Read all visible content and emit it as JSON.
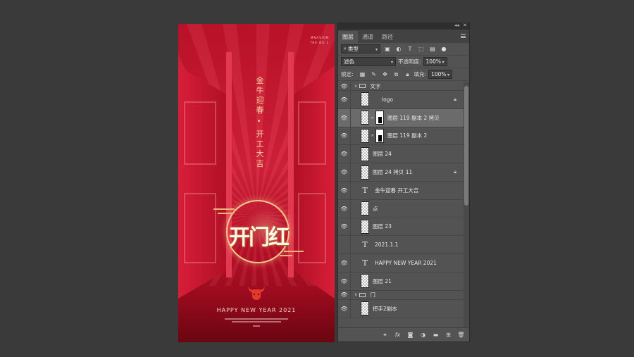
{
  "poster": {
    "brand_line1": "MNASION",
    "brand_line2": "THE NO.1",
    "vertical_line1": "金牛迎春",
    "vertical_line2": "开工大吉",
    "seal_text": "开门红",
    "headline": "HAPPY NEW YEAR 2021"
  },
  "panel": {
    "collapse": "◂◂",
    "close": "✕",
    "tabs": [
      "图层",
      "通道",
      "路径"
    ],
    "filter_label": "类型",
    "blend_mode": "滤色",
    "opacity_label": "不透明度:",
    "opacity_value": "100%",
    "lock_label": "锁定:",
    "fill_label": "填充:",
    "fill_value": "100%",
    "layers": [
      {
        "name": "文字",
        "kind": "group"
      },
      {
        "name": "logo",
        "kind": "pixel",
        "locked": true
      },
      {
        "name": "图层 119 副本 2 拷贝",
        "kind": "masked",
        "selected": true
      },
      {
        "name": "图层 119 副本 2",
        "kind": "masked"
      },
      {
        "name": "图层 24",
        "kind": "pixel"
      },
      {
        "name": "图层 24 拷贝 11",
        "kind": "pixel",
        "locked": true
      },
      {
        "name": "金牛迎春  开工大吉",
        "kind": "text"
      },
      {
        "name": "点",
        "kind": "pixel"
      },
      {
        "name": "图层 23",
        "kind": "pixel"
      },
      {
        "name": "2021.1.1",
        "kind": "text",
        "hidden": true
      },
      {
        "name": "HAPPY NEW YEAR 2021",
        "kind": "text"
      },
      {
        "name": "图层 21",
        "kind": "pixel"
      },
      {
        "name": "门",
        "kind": "group"
      },
      {
        "name": "把手2副本",
        "kind": "pixel"
      }
    ],
    "bottom_icons": [
      "link-icon",
      "fx-icon",
      "mask-icon",
      "adjustment-icon",
      "folder-icon",
      "new-layer-icon",
      "trash-icon"
    ]
  }
}
